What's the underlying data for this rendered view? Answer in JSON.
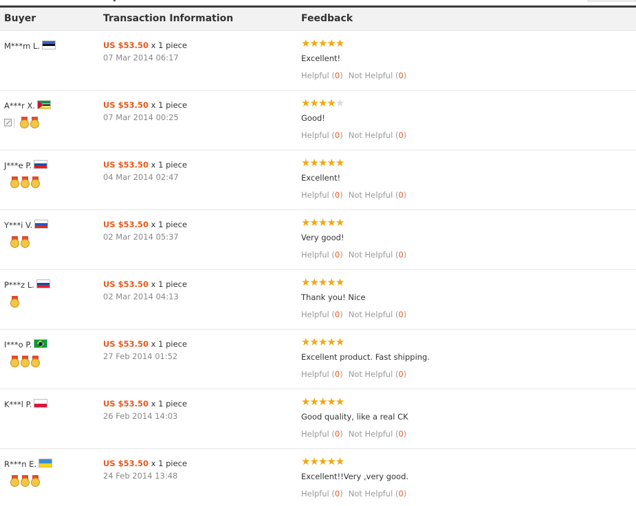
{
  "header": {
    "buyer": "Buyer",
    "transaction": "Transaction Information",
    "feedback": "Feedback"
  },
  "labels": {
    "quantity_suffix": " x 1 piece",
    "helpful": "Helpful",
    "not_helpful": "Not Helpful"
  },
  "colors": {
    "accent_orange": "#e8591c",
    "star": "#f3a70d",
    "header_bg": "#f2f2f2"
  },
  "reviews": [
    {
      "buyer": "M***m L.",
      "country": "Estonia",
      "flag_colors": [
        "#3a5fcd",
        "#111111",
        "#ffffff"
      ],
      "medals": 0,
      "has_edit_icon": false,
      "price": "US $53.50",
      "date": "07 Mar 2014 06:17",
      "rating": 5,
      "comment": "Excellent!",
      "helpful_count": "0",
      "not_helpful_count": "0"
    },
    {
      "buyer": "A***r X.",
      "country": "Mozambique",
      "flag_colors": [
        "#009a49",
        "#000000",
        "#fce100"
      ],
      "medals": 2,
      "has_edit_icon": true,
      "price": "US $53.50",
      "date": "07 Mar 2014 00:25",
      "rating": 4,
      "comment": "Good!",
      "helpful_count": "0",
      "not_helpful_count": "0"
    },
    {
      "buyer": "J***e P.",
      "country": "Slovenia",
      "flag_colors": [
        "#ffffff",
        "#0053a5",
        "#e11b22"
      ],
      "medals": 3,
      "has_edit_icon": false,
      "price": "US $53.50",
      "date": "04 Mar 2014 02:47",
      "rating": 5,
      "comment": "Excellent!",
      "helpful_count": "0",
      "not_helpful_count": "0"
    },
    {
      "buyer": "Y***i V.",
      "country": "Russia",
      "flag_colors": [
        "#ffffff",
        "#2456c8",
        "#d52b1e"
      ],
      "medals": 2,
      "has_edit_icon": false,
      "price": "US $53.50",
      "date": "02 Mar 2014 05:37",
      "rating": 5,
      "comment": "Very good!",
      "helpful_count": "0",
      "not_helpful_count": "0"
    },
    {
      "buyer": "P***z L.",
      "country": "Slovakia",
      "flag_colors": [
        "#ffffff",
        "#0b4ea2",
        "#ee1c25"
      ],
      "medals": 1,
      "has_edit_icon": false,
      "price": "US $53.50",
      "date": "02 Mar 2014 04:13",
      "rating": 5,
      "comment": "Thank you! Nice",
      "helpful_count": "0",
      "not_helpful_count": "0"
    },
    {
      "buyer": "I***o P.",
      "country": "Brazil",
      "flag_colors": [
        "#009c3b",
        "#ffdf00",
        "#002776"
      ],
      "medals": 3,
      "has_edit_icon": false,
      "price": "US $53.50",
      "date": "27 Feb 2014 01:52",
      "rating": 5,
      "comment": "Excellent product. Fast shipping.",
      "helpful_count": "0",
      "not_helpful_count": "0"
    },
    {
      "buyer": "K***l P.",
      "country": "Poland",
      "flag_colors": [
        "#ffffff",
        "#dc143c"
      ],
      "medals": 0,
      "has_edit_icon": false,
      "price": "US $53.50",
      "date": "26 Feb 2014 14:03",
      "rating": 5,
      "comment": "Good quality, like a real CK",
      "helpful_count": "0",
      "not_helpful_count": "0"
    },
    {
      "buyer": "R***n E.",
      "country": "Ukraine",
      "flag_colors": [
        "#3b8fd6",
        "#f9d616"
      ],
      "medals": 3,
      "has_edit_icon": false,
      "price": "US $53.50",
      "date": "24 Feb 2014 13:48",
      "rating": 5,
      "comment": "Excellent!!Very ,very good.",
      "helpful_count": "0",
      "not_helpful_count": "0"
    }
  ]
}
